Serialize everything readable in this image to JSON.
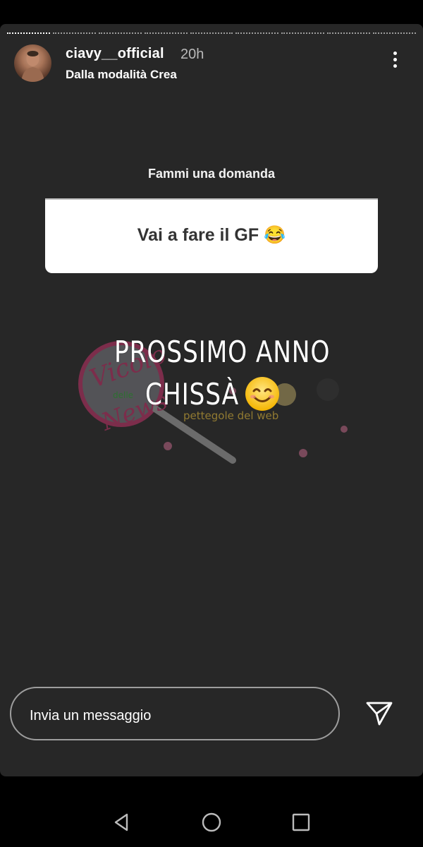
{
  "story": {
    "segments": 9,
    "active_segments": 1,
    "author": {
      "username": "ciavy__official",
      "time": "20h",
      "subtitle": "Dalla modalità Crea"
    },
    "question_sticker": {
      "title": "Fammi una domanda",
      "answer": "Vai a fare il GF 😂"
    },
    "reply": {
      "line1": "PROSSIMO ANNO",
      "line2": "CHISSÀ"
    },
    "watermark": {
      "script": "Vicolo",
      "small": "delle",
      "script2": "News",
      "tag": "pettegole del web"
    }
  },
  "message_bar": {
    "placeholder": "Invia un messaggio"
  },
  "icons": {
    "more": "more-vertical-icon",
    "send": "send-paper-plane-icon",
    "back": "triangle-back-icon",
    "home": "circle-home-icon",
    "recents": "square-recents-icon"
  }
}
